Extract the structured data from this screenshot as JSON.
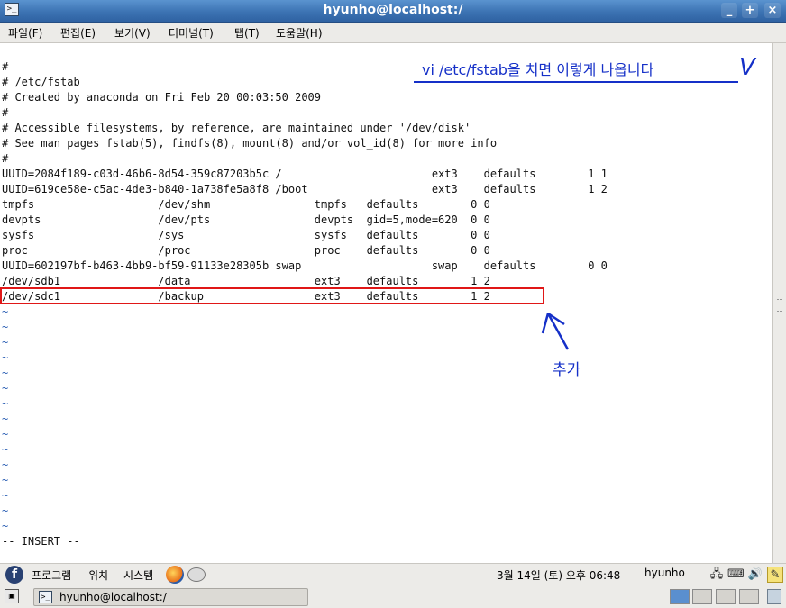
{
  "window": {
    "title": "hyunho@localhost:/",
    "icon": "terminal-icon",
    "buttons": {
      "minimize": "_",
      "maximize": "+",
      "close": "×"
    }
  },
  "menu": [
    "파일(F)",
    "편집(E)",
    "보기(V)",
    "터미널(T)",
    "탭(T)",
    "도움말(H)"
  ],
  "terminal": {
    "lines": [
      "#",
      "# /etc/fstab",
      "# Created by anaconda on Fri Feb 20 00:03:50 2009",
      "#",
      "# Accessible filesystems, by reference, are maintained under '/dev/disk'",
      "# See man pages fstab(5), findfs(8), mount(8) and/or vol_id(8) for more info",
      "#",
      "UUID=2084f189-c03d-46b6-8d54-359c87203b5c /                       ext3    defaults        1 1",
      "UUID=619ce58e-c5ac-4de3-b840-1a738fe5a8f8 /boot                   ext3    defaults        1 2",
      "tmpfs                   /dev/shm                tmpfs   defaults        0 0",
      "devpts                  /dev/pts                devpts  gid=5,mode=620  0 0",
      "sysfs                   /sys                    sysfs   defaults        0 0",
      "proc                    /proc                   proc    defaults        0 0",
      "UUID=602197bf-b463-4bb9-bf59-91133e28305b swap                    swap    defaults        0 0",
      "/dev/sdb1               /data                   ext3    defaults        1 2",
      "/dev/sdc1               /backup                 ext3    defaults        1 2"
    ],
    "tildes": [
      "~",
      "~",
      "~",
      "~",
      "~",
      "~",
      "~",
      "~",
      "~",
      "~",
      "~",
      "~",
      "~",
      "~",
      "~"
    ],
    "mode": "-- INSERT --"
  },
  "annotations": {
    "note": "vi /etc/fstab을 치면 이렇게 나옵니다",
    "v_mark": "V",
    "added_label": "추가",
    "color": "#1530c8",
    "highlight_color": "#e01717"
  },
  "panel": {
    "logo": "f",
    "menus": [
      "프로그램",
      "위치",
      "시스템"
    ],
    "clock": "3월 14일 (토) 오후 06:48",
    "user": "hyunho",
    "tray_icons": [
      "network-icon",
      "keyboard-icon",
      "volume-icon",
      "note-icon"
    ]
  },
  "taskbar": {
    "task_label": "hyunho@localhost:/",
    "workspaces": 4
  }
}
